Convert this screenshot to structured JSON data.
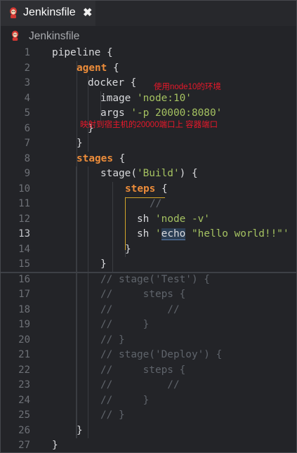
{
  "tab": {
    "label": "Jenkinsfile",
    "close": "✖",
    "icon": "jenkins-icon"
  },
  "breadcrumb": {
    "label": "Jenkinsfile",
    "icon": "jenkins-icon"
  },
  "editor": {
    "active_line": 13,
    "lines": [
      {
        "n": "1",
        "indent": 0,
        "tokens": [
          [
            "plain",
            "pipeline "
          ],
          [
            "plain",
            "{"
          ]
        ]
      },
      {
        "n": "2",
        "indent": 1,
        "tokens": [
          [
            "kw",
            "agent"
          ],
          [
            "plain",
            " {"
          ]
        ]
      },
      {
        "n": "3",
        "indent": 2,
        "tokens": [
          [
            "plain",
            "docker {"
          ]
        ]
      },
      {
        "n": "4",
        "indent": 3,
        "tokens": [
          [
            "plain",
            "image "
          ],
          [
            "str",
            "'node:10'"
          ]
        ]
      },
      {
        "n": "5",
        "indent": 3,
        "tokens": [
          [
            "plain",
            "args "
          ],
          [
            "str",
            "'-p 20000:8080'"
          ]
        ]
      },
      {
        "n": "6",
        "indent": 2,
        "tokens": [
          [
            "plain",
            "}"
          ]
        ]
      },
      {
        "n": "7",
        "indent": 1,
        "tokens": [
          [
            "plain",
            "}"
          ]
        ]
      },
      {
        "n": "8",
        "indent": 1,
        "tokens": [
          [
            "kw",
            "stages"
          ],
          [
            "plain",
            " {"
          ]
        ]
      },
      {
        "n": "9",
        "indent": 2,
        "tokens": [
          [
            "plain",
            "stage("
          ],
          [
            "str",
            "'Build'"
          ],
          [
            "plain",
            ") {"
          ]
        ]
      },
      {
        "n": "10",
        "indent": 3,
        "tokens": [
          [
            "kw",
            "steps"
          ],
          [
            "plain",
            " {"
          ]
        ]
      },
      {
        "n": "11",
        "indent": 4,
        "tokens": [
          [
            "cm",
            "//"
          ]
        ]
      },
      {
        "n": "12",
        "indent": 4,
        "tokens": [
          [
            "plain",
            "sh "
          ],
          [
            "str",
            "'node -v'"
          ]
        ]
      },
      {
        "n": "13",
        "indent": 4,
        "tokens": [
          [
            "plain",
            "sh "
          ],
          [
            "str",
            "'"
          ],
          [
            "hl",
            "echo"
          ],
          [
            "str",
            " \"hello world!!\"'"
          ]
        ]
      },
      {
        "n": "14",
        "indent": 3,
        "tokens": [
          [
            "plain",
            "}"
          ]
        ]
      },
      {
        "n": "15",
        "indent": 2,
        "tokens": [
          [
            "plain",
            "}"
          ]
        ]
      },
      {
        "n": "16",
        "indent": 2,
        "tokens": [
          [
            "cm",
            "// stage('Test') {"
          ]
        ]
      },
      {
        "n": "17",
        "indent": 2,
        "tokens": [
          [
            "cm",
            "//     steps {"
          ]
        ]
      },
      {
        "n": "18",
        "indent": 2,
        "tokens": [
          [
            "cm",
            "//         //"
          ]
        ]
      },
      {
        "n": "19",
        "indent": 2,
        "tokens": [
          [
            "cm",
            "//     }"
          ]
        ]
      },
      {
        "n": "20",
        "indent": 2,
        "tokens": [
          [
            "cm",
            "// }"
          ]
        ]
      },
      {
        "n": "21",
        "indent": 2,
        "tokens": [
          [
            "cm",
            "// stage('Deploy') {"
          ]
        ]
      },
      {
        "n": "22",
        "indent": 2,
        "tokens": [
          [
            "cm",
            "//     steps {"
          ]
        ]
      },
      {
        "n": "23",
        "indent": 2,
        "tokens": [
          [
            "cm",
            "//         //"
          ]
        ]
      },
      {
        "n": "24",
        "indent": 2,
        "tokens": [
          [
            "cm",
            "//     }"
          ]
        ]
      },
      {
        "n": "25",
        "indent": 2,
        "tokens": [
          [
            "cm",
            "// }"
          ]
        ]
      },
      {
        "n": "26",
        "indent": 1,
        "tokens": [
          [
            "plain",
            "}"
          ]
        ]
      },
      {
        "n": "27",
        "indent": 0,
        "tokens": [
          [
            "plain",
            "}"
          ]
        ]
      }
    ]
  },
  "annotations": {
    "node10_env": "使用node10的环境",
    "port_mapping": "映射到宿主机的20000端口上  容器端口"
  },
  "colors": {
    "background": "#232428",
    "keyword": "#ec8c3a",
    "string": "#a5c261",
    "comment": "#5f646b",
    "annotation": "#e8182a",
    "bracket_match": "#d2a52a"
  }
}
